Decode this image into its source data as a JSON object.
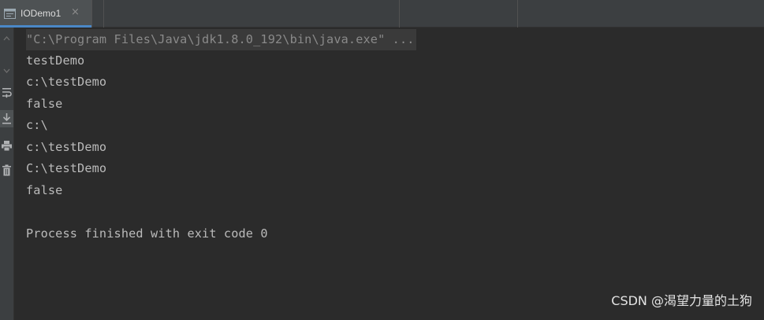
{
  "tab": {
    "icon": "console-window-icon",
    "label": "IODemo1",
    "close_glyph": "×"
  },
  "toolstrip": {
    "tools": [
      "scroll-up-icon",
      "scroll-down-icon",
      "soft-wrap-icon",
      "scroll-to-end-icon",
      "print-icon",
      "clear-all-icon"
    ]
  },
  "console": {
    "command": "\"C:\\Program Files\\Java\\jdk1.8.0_192\\bin\\java.exe\" ...",
    "output": [
      "testDemo",
      "c:\\testDemo",
      "false",
      "c:\\",
      "c:\\testDemo",
      "C:\\testDemo",
      "false",
      "",
      "Process finished with exit code 0"
    ]
  },
  "watermark": "CSDN @渴望力量的土狗",
  "colors": {
    "background": "#2b2b2b",
    "text": "#bbbbbb",
    "command_text": "#8a8a8a",
    "tab_accent": "#4a88c7"
  }
}
